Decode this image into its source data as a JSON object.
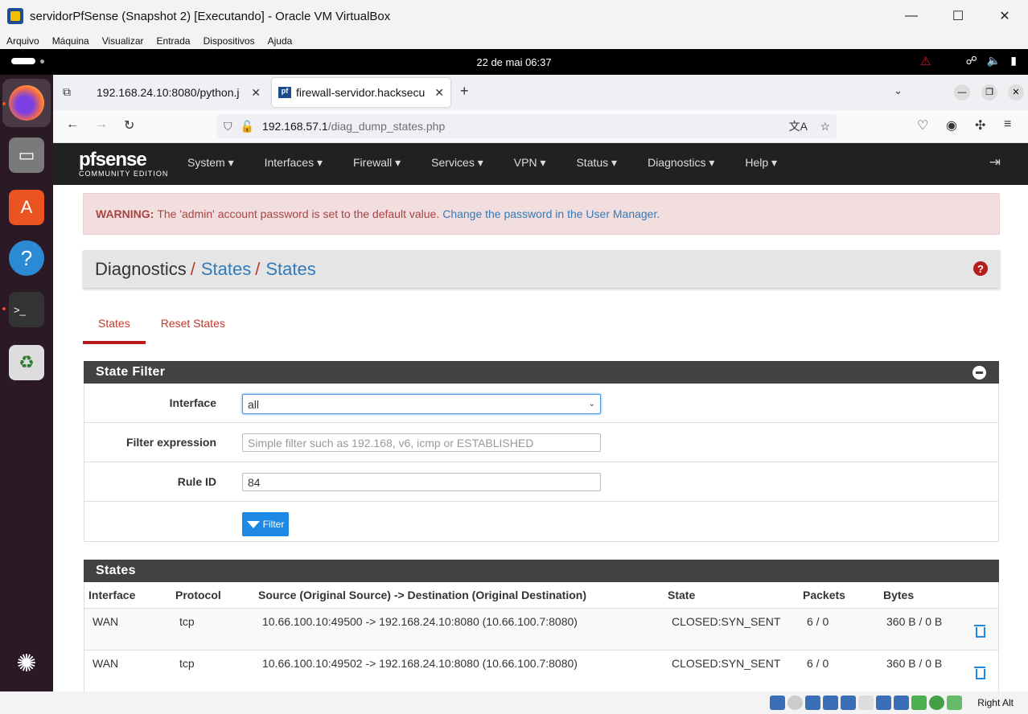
{
  "window": {
    "title": "servidorPfSense (Snapshot 2) [Executando] - Oracle VM VirtualBox",
    "minimize": "—",
    "maximize": "☐",
    "close": "✕"
  },
  "vb_menu": [
    "Arquivo",
    "Máquina",
    "Visualizar",
    "Entrada",
    "Dispositivos",
    "Ajuda"
  ],
  "gnome": {
    "clock": "22 de mai  06:37"
  },
  "browser": {
    "tabs": [
      {
        "title": "192.168.24.10:8080/python.j"
      },
      {
        "title": "firewall-servidor.hacksecu"
      }
    ],
    "new_tab": "+",
    "url_host": "192.168.57.1",
    "url_path": "/diag_dump_states.php"
  },
  "pfsense": {
    "logo_main": "pfsense",
    "logo_sub": "COMMUNITY EDITION",
    "menu": [
      "System ▾",
      "Interfaces ▾",
      "Firewall ▾",
      "Services ▾",
      "VPN ▾",
      "Status ▾",
      "Diagnostics ▾",
      "Help ▾"
    ],
    "alert": {
      "label": "WARNING:",
      "text": "The 'admin' account password is set to the default value.",
      "link": "Change the password in the User Manager."
    },
    "breadcrumb": {
      "root": "Diagnostics",
      "sep": "/",
      "level1": "States",
      "level2": "States"
    },
    "help_icon": "?",
    "subtabs": [
      "States",
      "Reset States"
    ],
    "filter_panel": {
      "title": "State Filter",
      "interface_label": "Interface",
      "interface_value": "all",
      "expr_label": "Filter expression",
      "expr_placeholder": "Simple filter such as 192.168, v6, icmp or ESTABLISHED",
      "rule_label": "Rule ID",
      "rule_value": "84",
      "filter_button": "Filter"
    },
    "states_panel": {
      "title": "States",
      "columns": [
        "Interface",
        "Protocol",
        "Source (Original Source) -> Destination (Original Destination)",
        "State",
        "Packets",
        "Bytes"
      ],
      "rows": [
        [
          "WAN",
          "tcp",
          "10.66.100.10:49500 -> 192.168.24.10:8080 (10.66.100.7:8080)",
          "CLOSED:SYN_SENT",
          "6 / 0",
          "360 B / 0 B"
        ],
        [
          "WAN",
          "tcp",
          "10.66.100.10:49502 -> 192.168.24.10:8080 (10.66.100.7:8080)",
          "CLOSED:SYN_SENT",
          "6 / 0",
          "360 B / 0 B"
        ]
      ]
    }
  },
  "status_bar": {
    "host_key": "Right Alt"
  }
}
